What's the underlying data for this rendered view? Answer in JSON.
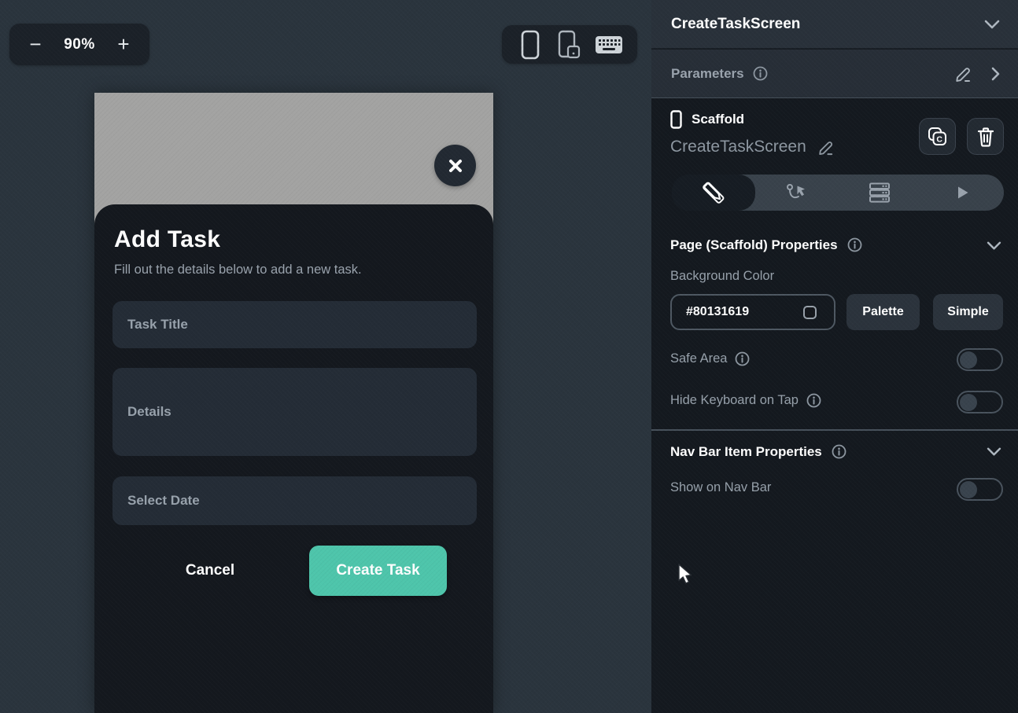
{
  "canvas": {
    "zoom": {
      "minus": "−",
      "level": "90%",
      "plus": "+"
    },
    "device_toolbar": {
      "icons": [
        "phone",
        "rotate-device",
        "keyboard"
      ]
    },
    "preview": {
      "scrim_color": "#A3A3A2",
      "modal": {
        "title": "Add Task",
        "subtitle": "Fill out the details below to add a new task.",
        "fields": [
          {
            "placeholder": "Task Title"
          },
          {
            "placeholder": "Details"
          },
          {
            "placeholder": "Select Date"
          }
        ],
        "cancel_label": "Cancel",
        "submit_label": "Create Task",
        "submit_color": "#4EC5AB"
      }
    }
  },
  "panel": {
    "screen_title": "CreateTaskScreen",
    "parameters": {
      "label": "Parameters"
    },
    "widget": {
      "type": "Scaffold",
      "name": "CreateTaskScreen"
    },
    "tabs": [
      {
        "icon": "ruler-pencil",
        "active": true
      },
      {
        "icon": "actions-flow",
        "active": false
      },
      {
        "icon": "database",
        "active": false
      },
      {
        "icon": "test-play",
        "active": false
      }
    ],
    "page_properties": {
      "title": "Page (Scaffold) Properties",
      "background_color": {
        "label": "Background Color",
        "value": "#80131619",
        "palette_label": "Palette",
        "simple_label": "Simple"
      },
      "safe_area": {
        "label": "Safe Area",
        "enabled": false
      },
      "hide_keyboard": {
        "label": "Hide Keyboard on Tap",
        "enabled": false
      }
    },
    "nav_bar": {
      "title": "Nav Bar Item Properties",
      "show_on_nav_bar": {
        "label": "Show on Nav Bar",
        "enabled": false
      }
    }
  }
}
